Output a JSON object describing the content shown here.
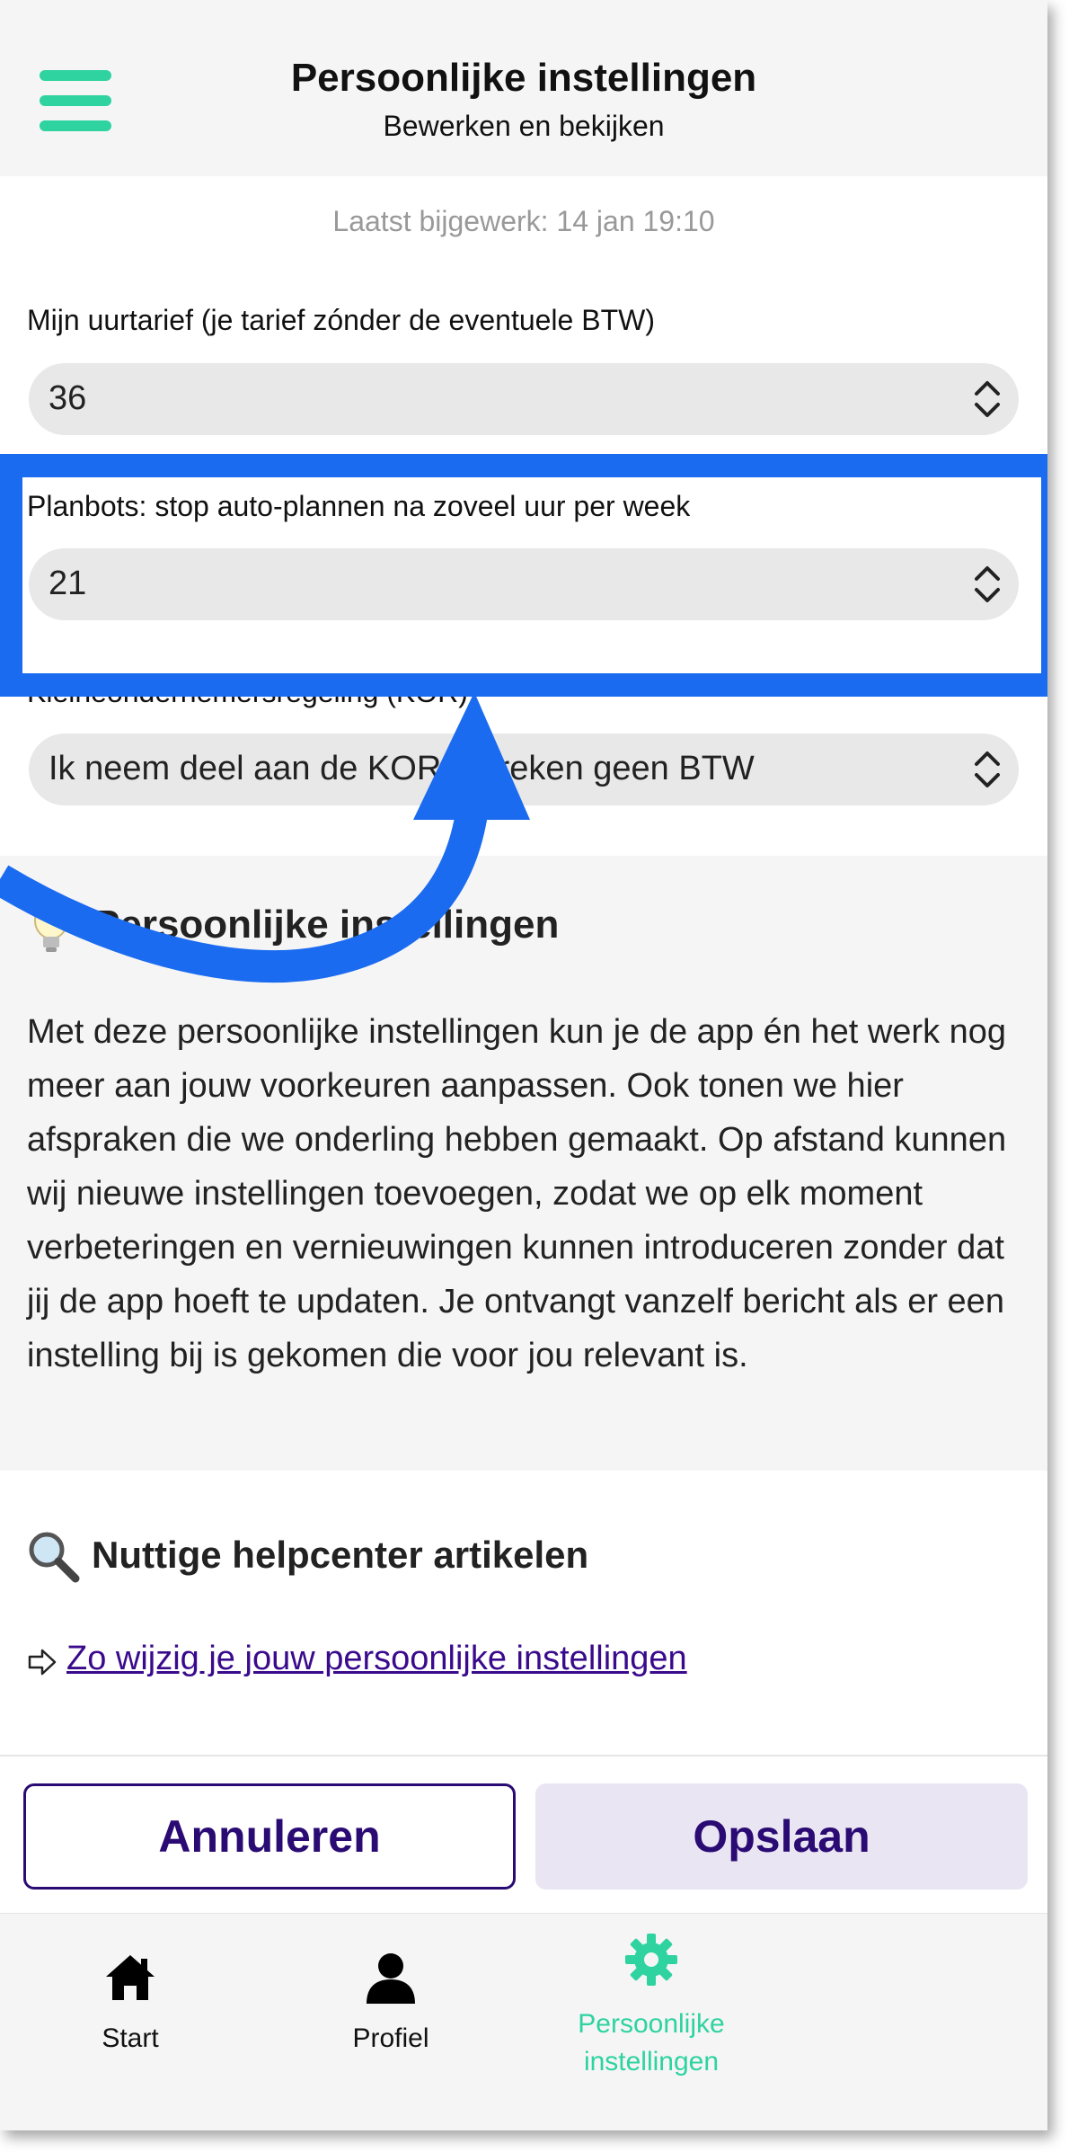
{
  "header": {
    "title": "Persoonlijke instellingen",
    "subtitle": "Bewerken en bekijken",
    "menu_icon": "hamburger-menu-icon"
  },
  "last_updated": "Laatst bijgewerk: 14 jan 19:10",
  "fields": [
    {
      "label": "Mijn uurtarief (je tarief zónder de eventuele BTW)",
      "value": "36"
    },
    {
      "label": "Planbots: stop auto-plannen na zoveel uur per week",
      "value": "21"
    },
    {
      "label": "Kleineondernemersregeling (KOR)",
      "value": "Ik neem deel aan de KOR en reken geen BTW"
    }
  ],
  "info": {
    "icon": "lightbulb-icon",
    "title": "Persoonlijke instellingen",
    "body": "Met deze persoonlijke instellingen kun je de app én het werk nog meer aan jouw voorkeuren aanpassen. Ook tonen we hier afspraken die we onderling hebben gemaakt. Op afstand kunnen wij nieuwe instellingen toevoegen, zodat we op elk moment verbeteringen en vernieuwingen kunnen introduceren zonder dat jij de app hoeft te updaten. Je ontvangt vanzelf bericht als er een instelling bij is gekomen die voor jou relevant is."
  },
  "help": {
    "icon": "magnifier-icon",
    "title": "Nuttige helpcenter artikelen",
    "link_icon": "arrow-right-icon",
    "link": "Zo wijzig je jouw persoonlijke instellingen"
  },
  "actions": {
    "cancel": "Annuleren",
    "save": "Opslaan"
  },
  "tabs": [
    {
      "label": "Start",
      "icon": "home-icon"
    },
    {
      "label": "Profiel",
      "icon": "person-icon"
    },
    {
      "label": "Persoonlijke instellingen",
      "icon": "gear-icon",
      "active": true
    }
  ],
  "colors": {
    "accent": "#2ed3a0",
    "primary": "#2a0a73",
    "highlight": "#1a6bf0"
  }
}
